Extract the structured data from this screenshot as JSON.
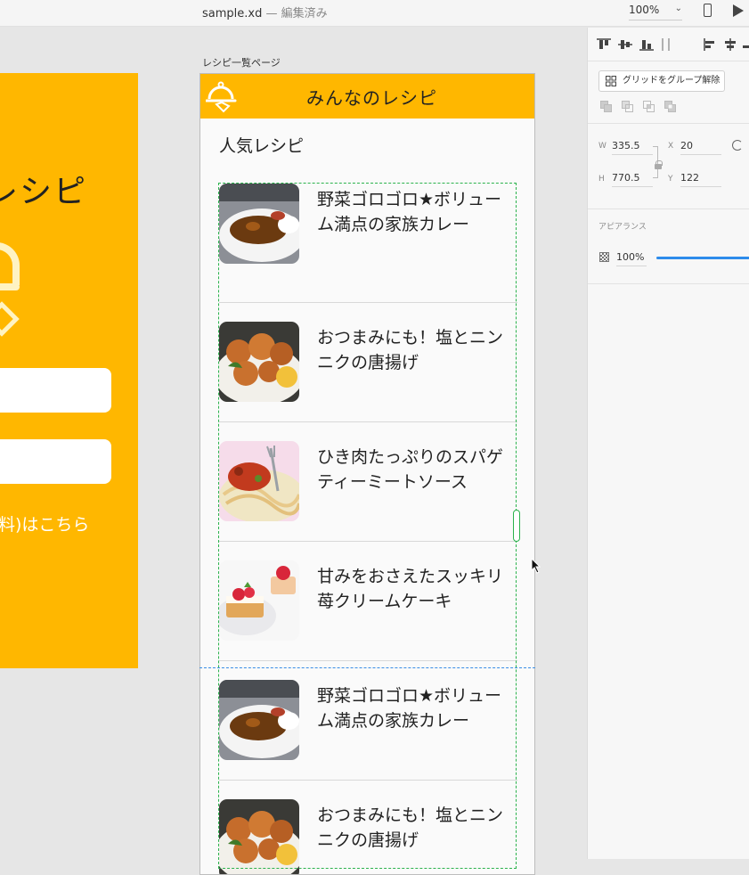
{
  "topbar": {
    "file_name": "sample.xd",
    "separator": "—",
    "status": "編集済み",
    "zoom": "100%",
    "zoom_chevron": "⌄"
  },
  "left_artboard": {
    "title_fragment": "レシピ",
    "link_fragment": "料)はこちら"
  },
  "artboard": {
    "label": "レシピ一覧ページ",
    "header_title": "みんなのレシピ",
    "section_title": "人気レシピ",
    "recipes": [
      {
        "name": "野菜ゴロゴロ★ボリューム満点の家族カレー",
        "thumb": "curry"
      },
      {
        "name": "おつまみにも！塩とニンニクの唐揚げ",
        "thumb": "karaage"
      },
      {
        "name": "ひき肉たっぷりのスパゲティーミートソース",
        "thumb": "spaghetti"
      },
      {
        "name": "甘みをおさえたスッキリ苺クリームケーキ",
        "thumb": "cake"
      },
      {
        "name": "野菜ゴロゴロ★ボリューム満点の家族カレー",
        "thumb": "curry"
      },
      {
        "name": "おつまみにも！塩とニンニクの唐揚げ",
        "thumb": "karaage"
      }
    ]
  },
  "panel": {
    "ungroup_label": "グリッドをグループ解除",
    "w_label": "W",
    "w": "335.5",
    "x_label": "X",
    "x": "20",
    "h_label": "H",
    "h": "770.5",
    "y_label": "Y",
    "y": "122",
    "appearance_label": "アピアランス",
    "opacity": "100%"
  },
  "colors": {
    "brand": "#ffb700",
    "selection": "#2bb24c",
    "guide": "#3a8ee6",
    "slider": "#2d8ceb"
  }
}
